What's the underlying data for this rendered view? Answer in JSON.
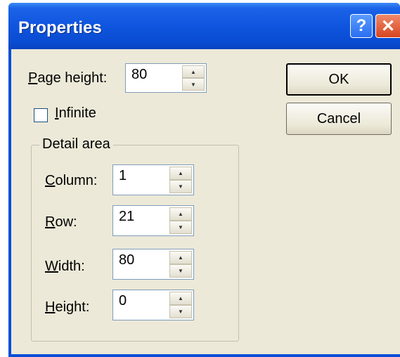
{
  "window": {
    "title": "Properties",
    "help_glyph": "?",
    "close_glyph": "✕"
  },
  "page_height": {
    "label_accel": "P",
    "label_rest": "age height:",
    "value": "80"
  },
  "infinite": {
    "label_accel": "I",
    "label_rest": "nfinite",
    "checked": false
  },
  "detail_area": {
    "title": "Detail area",
    "column": {
      "label_accel": "C",
      "label_rest": "olumn:",
      "value": "1"
    },
    "row": {
      "label_accel": "R",
      "label_rest": "ow:",
      "value": "21"
    },
    "width": {
      "label_accel": "W",
      "label_rest": "idth:",
      "value": "80"
    },
    "height": {
      "label_accel": "H",
      "label_rest": "eight:",
      "value": "0"
    }
  },
  "buttons": {
    "ok": "OK",
    "cancel": "Cancel"
  },
  "spin_glyphs": {
    "up": "▲",
    "down": "▼"
  },
  "colors": {
    "titlebar": "#0a4fd8",
    "dialog_bg": "#ece9d8",
    "close_button": "#d7441f"
  }
}
